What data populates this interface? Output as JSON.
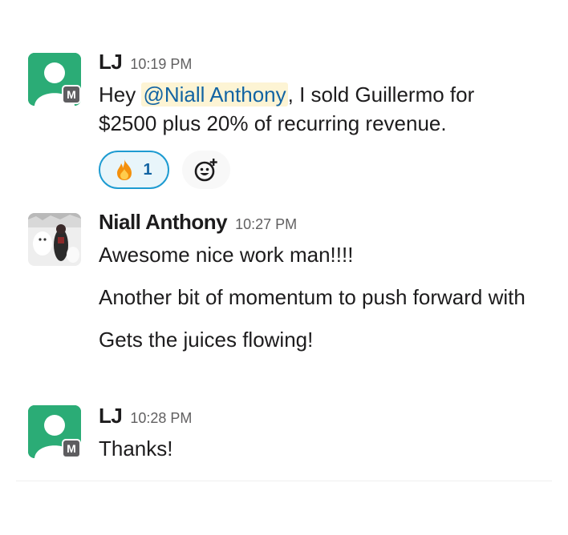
{
  "messages": [
    {
      "sender": "LJ",
      "time": "10:19 PM",
      "badge": "M",
      "text_before": "Hey ",
      "mention": "@Niall Anthony",
      "text_after": ", I sold Guillermo for $2500 plus 20% of recurring revenue.",
      "reaction": {
        "emoji_name": "fire-icon",
        "count": "1"
      }
    },
    {
      "sender": "Niall Anthony",
      "time": "10:27 PM",
      "lines": [
        "Awesome nice work man!!!!",
        "Another bit of momentum to push forward with",
        "Gets the juices flowing!"
      ]
    },
    {
      "sender": "LJ",
      "time": "10:28 PM",
      "badge": "M",
      "text": "Thanks!"
    }
  ],
  "colors": {
    "avatar_green": "#2bac76",
    "mention_bg": "#fdf4d4",
    "mention_text": "#1264a3",
    "reaction_border": "#1d9bd1"
  }
}
